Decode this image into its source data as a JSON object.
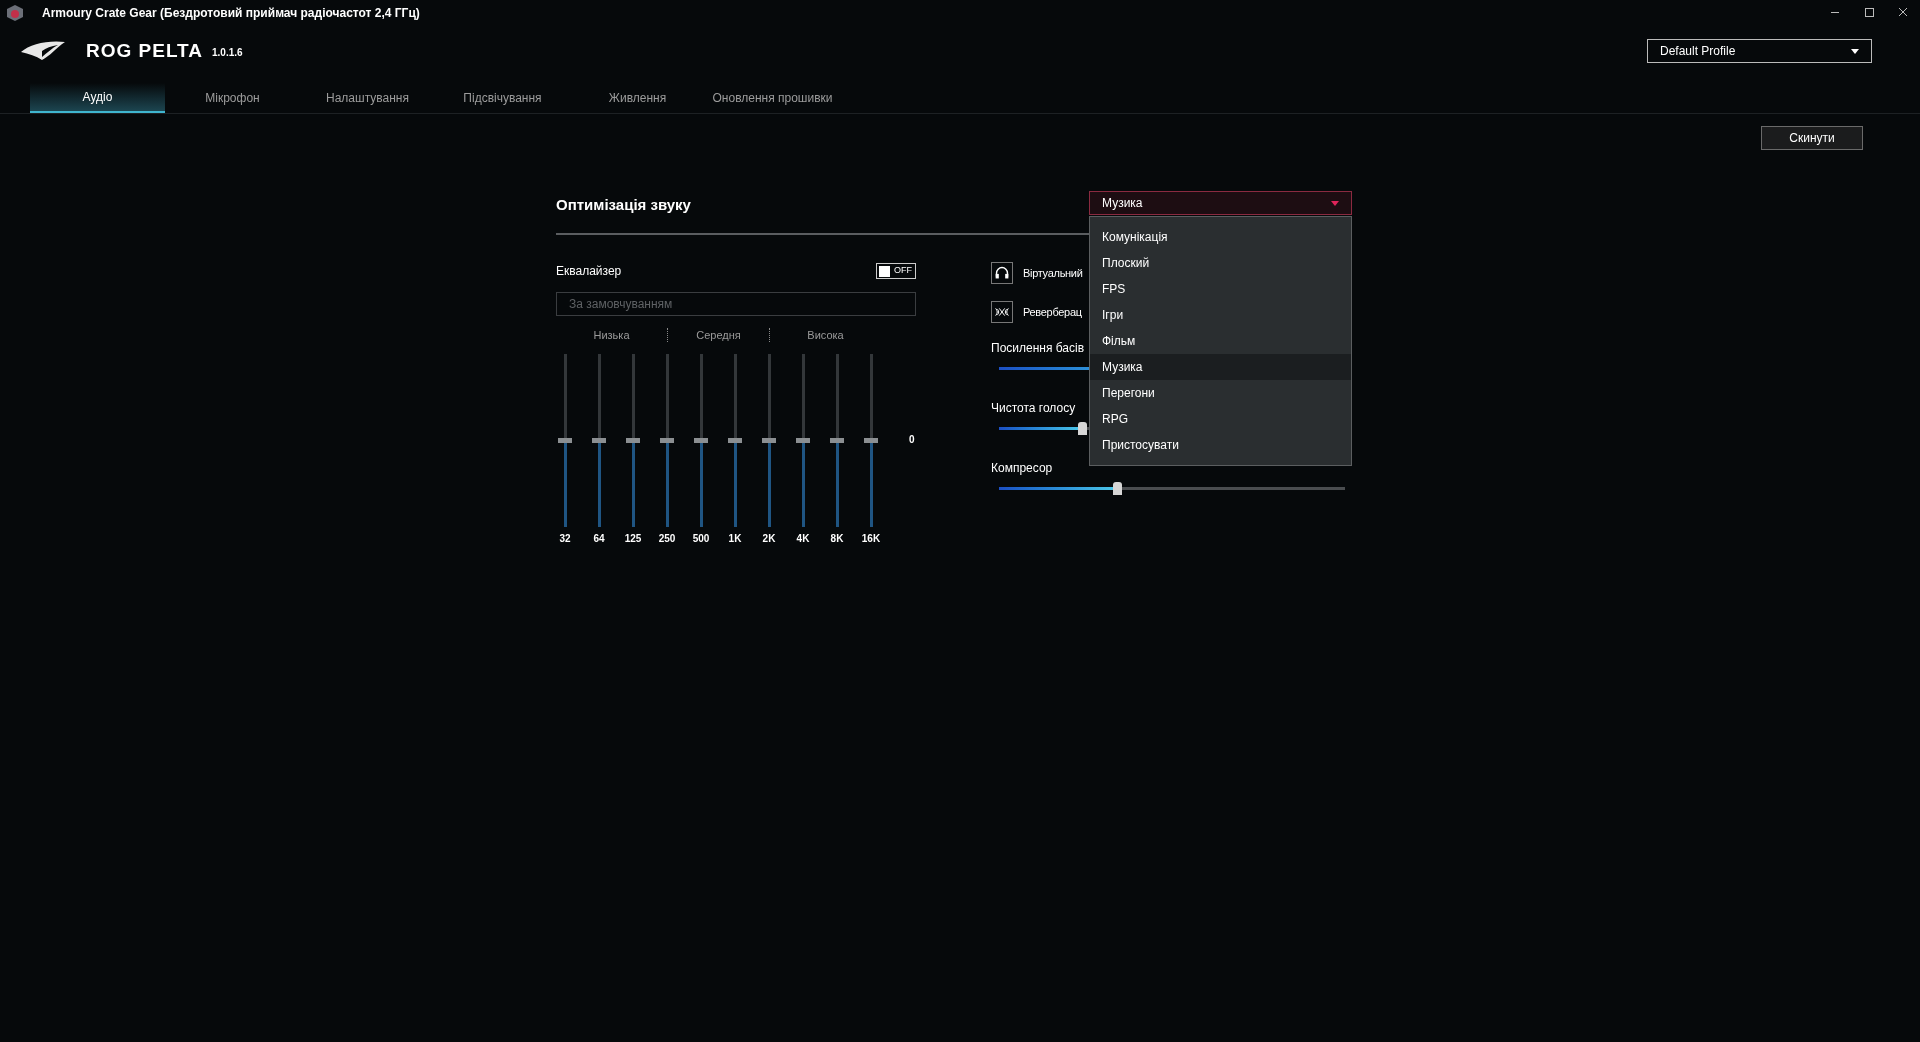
{
  "window": {
    "title": "Armoury Crate Gear (Бездротовий приймач радіочастот 2,4 ГГц)"
  },
  "header": {
    "product": "ROG PELTA",
    "version": "1.0.1.6",
    "profile": "Default Profile"
  },
  "tabs": [
    {
      "label": "Аудіо",
      "selected": true
    },
    {
      "label": "Мікрофон",
      "selected": false
    },
    {
      "label": "Налаштування",
      "selected": false
    },
    {
      "label": "Підсвічування",
      "selected": false
    },
    {
      "label": "Живлення",
      "selected": false
    },
    {
      "label": "Оновлення прошивки",
      "selected": false
    }
  ],
  "reset_button": "Скинути",
  "sound_optimization": {
    "title": "Оптимізація звуку",
    "preset": {
      "value": "Музика",
      "expanded": true,
      "options": [
        {
          "label": "Комунікація",
          "selected": false
        },
        {
          "label": "Плоский",
          "selected": false
        },
        {
          "label": "FPS",
          "selected": false
        },
        {
          "label": "Ігри",
          "selected": false
        },
        {
          "label": "Фільм",
          "selected": false
        },
        {
          "label": "Музика",
          "selected": true
        },
        {
          "label": "Перегони",
          "selected": false
        },
        {
          "label": "RPG",
          "selected": false
        },
        {
          "label": "Пристосувати",
          "selected": false
        }
      ]
    }
  },
  "equalizer": {
    "label": "Еквалайзер",
    "on": false,
    "toggle_text": "OFF",
    "preset": {
      "value": "За замовчуванням",
      "disabled": true
    },
    "ranges": [
      "Низька",
      "Середня",
      "Висока"
    ],
    "value_label": "0",
    "bands": [
      {
        "label": "32",
        "level": 0.5
      },
      {
        "label": "64",
        "level": 0.5
      },
      {
        "label": "125",
        "level": 0.5
      },
      {
        "label": "250",
        "level": 0.5
      },
      {
        "label": "500",
        "level": 0.5
      },
      {
        "label": "1K",
        "level": 0.5
      },
      {
        "label": "2K",
        "level": 0.5
      },
      {
        "label": "4K",
        "level": 0.5
      },
      {
        "label": "8K",
        "level": 0.5
      },
      {
        "label": "16K",
        "level": 0.5
      }
    ]
  },
  "effects": [
    {
      "kind": "surround",
      "label": "Віртуальний"
    },
    {
      "kind": "reverb",
      "label": "Реверберац"
    }
  ],
  "sliders": [
    {
      "label": "Посилення басів",
      "level": 0.5
    },
    {
      "label": "Чистота голосу",
      "level": 0.24
    },
    {
      "label": "Компресор",
      "level": 0.34
    }
  ]
}
